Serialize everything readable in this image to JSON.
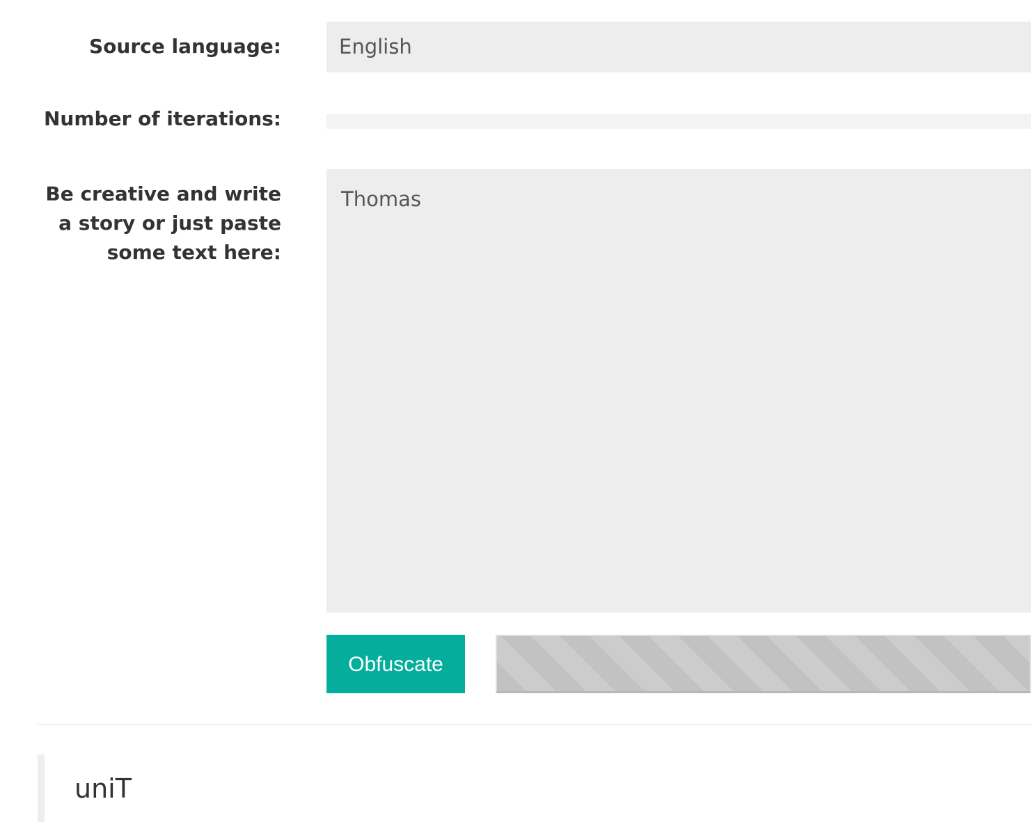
{
  "form": {
    "source_language_label": "Source language:",
    "source_language_value": "English",
    "iterations_label": "Number of iterations:",
    "text_label": "Be creative and write a story or just paste some text here:",
    "text_value": "Thomas",
    "submit_label": "Obfuscate"
  },
  "output": {
    "text": "uniT"
  },
  "colors": {
    "accent": "#05ae9c",
    "field_background": "#ededed",
    "label_text": "#333333"
  }
}
